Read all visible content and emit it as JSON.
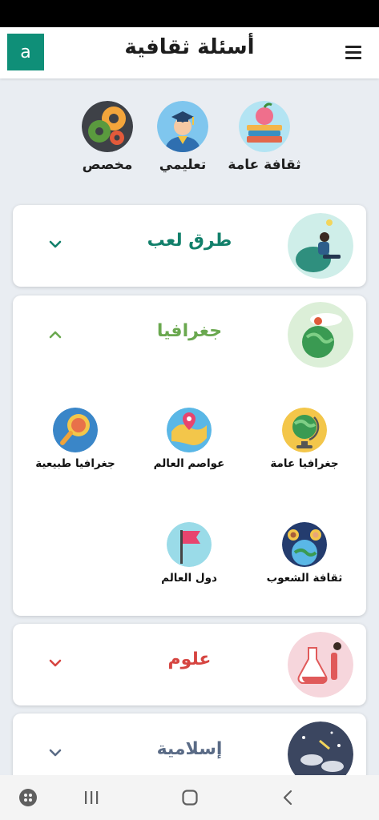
{
  "app": {
    "title": "أسئلة ثقافية",
    "avatar_letter": "a",
    "accent": "#0f8f78"
  },
  "categories": [
    {
      "label": "ثقافة عامة",
      "icon": "books-apple-icon"
    },
    {
      "label": "تعليمي",
      "icon": "graduate-icon"
    },
    {
      "label": "مخصص",
      "icon": "gears-icon"
    }
  ],
  "sections": [
    {
      "title": "طرق لعب",
      "color": "#12806b",
      "expanded": false,
      "icon": "person-thinking-icon"
    },
    {
      "title": "جغرافيا",
      "color": "#6aa84f",
      "expanded": true,
      "icon": "globe-person-icon",
      "items": [
        {
          "label": "جغرافيا عامة",
          "icon": "desk-globe-icon"
        },
        {
          "label": "عواصم العالم",
          "icon": "map-pin-icon"
        },
        {
          "label": "جغرافيا طبيعية",
          "icon": "magnifier-earth-icon"
        },
        {
          "label": "ثقافة الشعوب",
          "icon": "people-earth-icon"
        },
        {
          "label": "دول العالم",
          "icon": "flag-icon"
        }
      ]
    },
    {
      "title": "علوم",
      "color": "#d64541",
      "expanded": false,
      "icon": "chemistry-lab-icon"
    },
    {
      "title": "إسلامية",
      "color": "#5a6b86",
      "expanded": false,
      "icon": "night-sky-icon"
    }
  ],
  "navigation": [
    "apps-icon",
    "recent-apps-icon",
    "home-icon",
    "back-icon"
  ]
}
